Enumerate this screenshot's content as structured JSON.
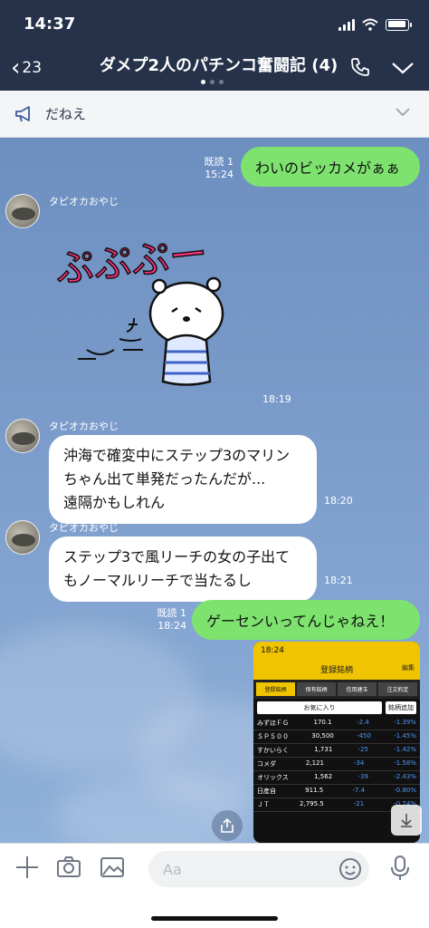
{
  "status": {
    "time": "14:37"
  },
  "header": {
    "back_count": "23",
    "title": "ダメプ2人のパチンコ奮闘記 (4)"
  },
  "announcement": {
    "text": "だねえ"
  },
  "messages": [
    {
      "type": "out",
      "read": "既読 1",
      "time": "15:24",
      "text": "わいのビッカメがぁぁ"
    },
    {
      "type": "sticker",
      "sender": "タピオカおやじ",
      "sticker_text": "ぷぷぷー",
      "time": "18:19"
    },
    {
      "type": "in",
      "sender": "タピオカおやじ",
      "lines": [
        "沖海で確変中にステップ3のマリン",
        "ちゃん出て単発だったんだが...",
        "遠隔かもしれん"
      ],
      "time": "18:20"
    },
    {
      "type": "in",
      "sender": "タピオカおやじ",
      "lines": [
        "ステップ3で風リーチの女の子出て",
        "もノーマルリーチで当たるし"
      ],
      "time": "18:21"
    },
    {
      "type": "out",
      "read": "既読 1",
      "time": "18:24",
      "text": "ゲーセンいってんじゃねえ！"
    }
  ],
  "screenshot": {
    "time": "18:24",
    "title": "登録銘柄",
    "edit": "編集",
    "tabs": [
      "登録銘柄",
      "保有銘柄",
      "信用建玉",
      "注文約定"
    ],
    "fav_label": "お気に入り",
    "add_label": "銘柄追加",
    "rows": [
      {
        "name": "みずほＦＧ",
        "price": "170.1",
        "change": "-2.4",
        "pct": "-1.39%"
      },
      {
        "name": "ＳＰ５００",
        "price": "30,500",
        "change": "-450",
        "pct": "-1.45%"
      },
      {
        "name": "すかいらく",
        "price": "1,731",
        "change": "-25",
        "pct": "-1.42%"
      },
      {
        "name": "コメダ",
        "price": "2,121",
        "change": "-34",
        "pct": "-1.58%"
      },
      {
        "name": "オリックス",
        "price": "1,562",
        "change": "-39",
        "pct": "-2.43%"
      },
      {
        "name": "日産自",
        "price": "911.5",
        "change": "-7.4",
        "pct": "-0.80%"
      },
      {
        "name": "ＪＴ",
        "price": "2,795.5",
        "change": "-21",
        "pct": "-0.74%"
      }
    ]
  },
  "input": {
    "placeholder": "Aa"
  },
  "colors": {
    "header_bg": "#25324a",
    "out_bubble": "#7ee36e",
    "in_bubble": "#ffffff",
    "chat_bg": "#7f9fcb"
  }
}
